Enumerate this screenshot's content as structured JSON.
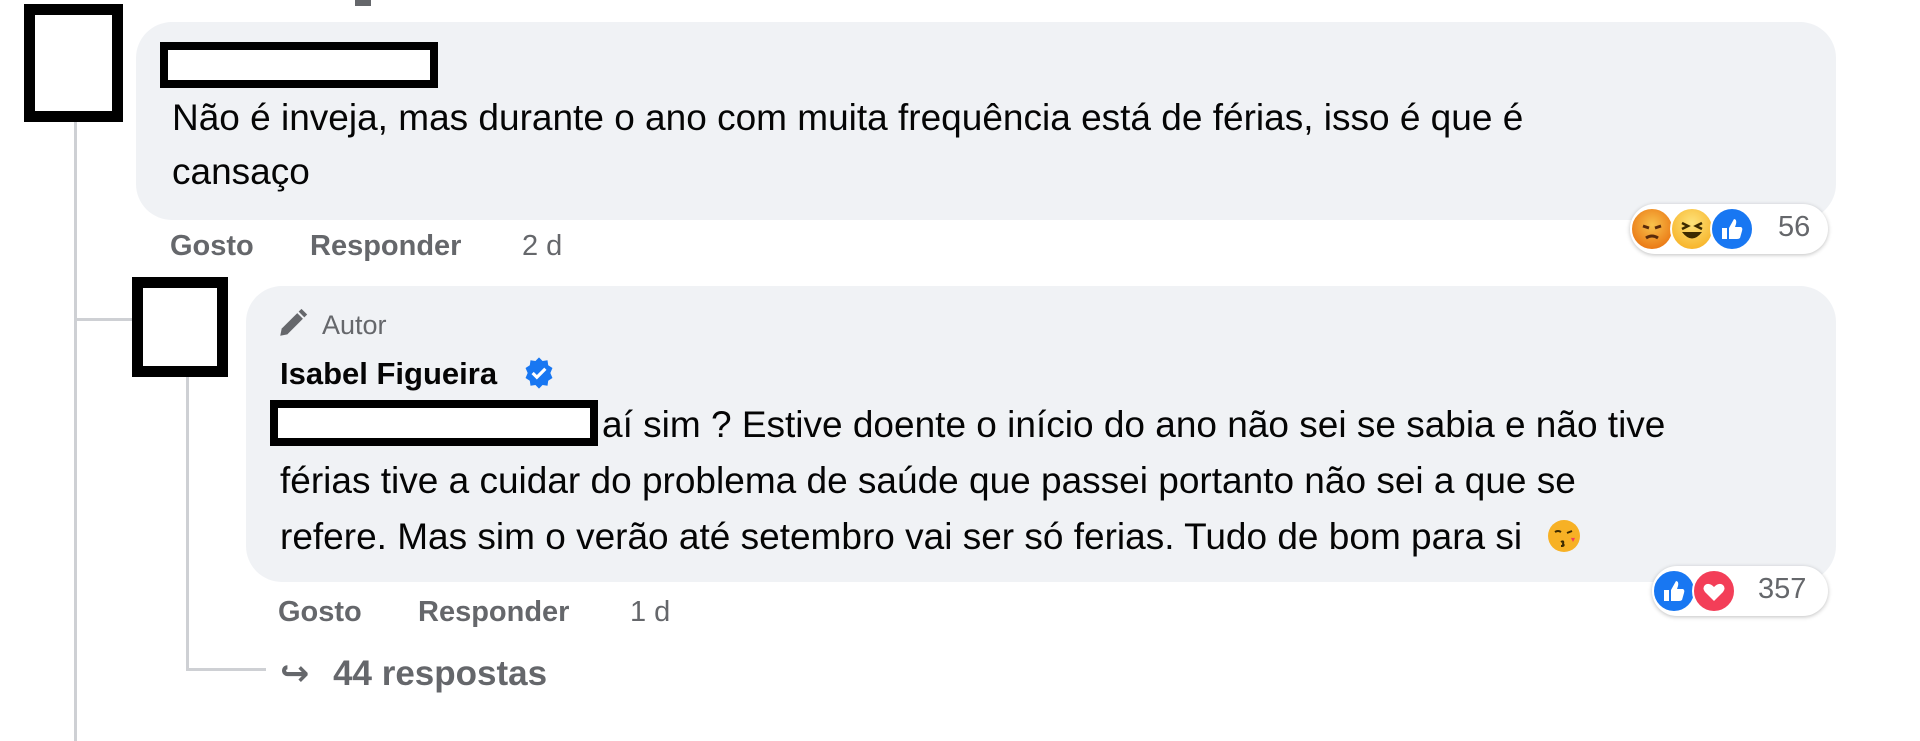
{
  "colors": {
    "bubble_bg": "#f0f2f5",
    "meta_text": "#65676b",
    "like_blue": "#1877f2",
    "love_red": "#f33e58",
    "angry_orange": "#e9710f",
    "haha_yellow": "#f7b125"
  },
  "comment1": {
    "text_line1": "Não é inveja, mas durante o ano com muita frequência está de férias, isso é que é",
    "text_line2": "cansaço",
    "actions": {
      "like": "Gosto",
      "reply": "Responder",
      "time": "2 d"
    },
    "reactions": {
      "icons": [
        "angry-icon",
        "haha-icon",
        "like-icon"
      ],
      "count": "56"
    }
  },
  "comment2": {
    "badge": "Autor",
    "author": "Isabel Figueira",
    "verified_icon": "verified-badge-icon",
    "text_line1": "aí sim ? Estive doente o início do ano não sei se sabia e não tive",
    "text_line2": "férias tive a cuidar do problema de saúde que passei portanto não sei a que se",
    "text_line3": "refere. Mas sim o verão até setembro vai ser só ferias. Tudo de bom para si",
    "emoji": "😘",
    "actions": {
      "like": "Gosto",
      "reply": "Responder",
      "time": "1 d"
    },
    "reactions": {
      "icons": [
        "like-icon",
        "love-icon"
      ],
      "count": "357"
    }
  },
  "replies": {
    "arrow": "↪",
    "label": "44 respostas"
  }
}
